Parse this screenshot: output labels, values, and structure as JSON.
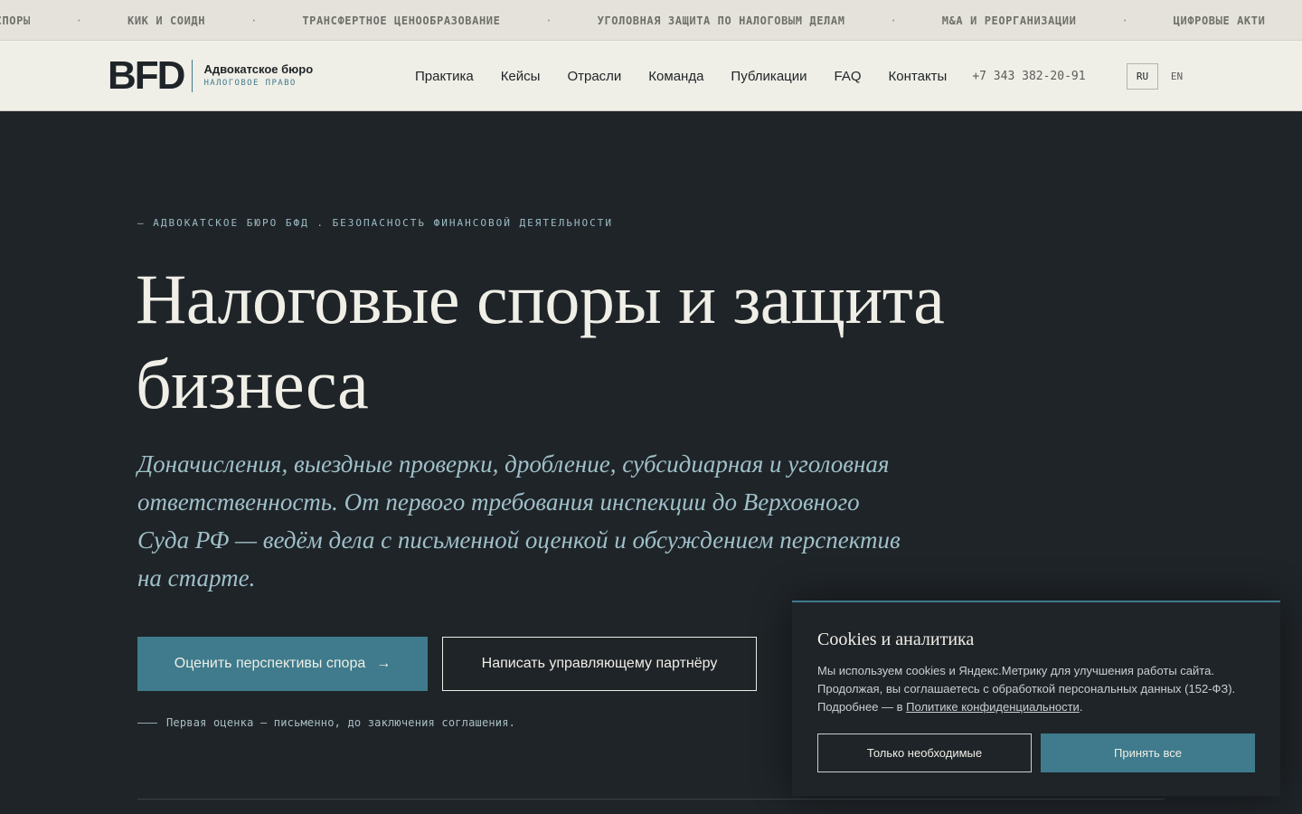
{
  "ticker": {
    "items": [
      "Е СПОРЫ",
      "КИК И СОИДН",
      "ТРАНСФЕРТНОЕ ЦЕНООБРАЗОВАНИЕ",
      "УГОЛОВНАЯ ЗАЩИТА ПО НАЛОГОВЫМ ДЕЛАМ",
      "M&A И РЕОРГАНИЗАЦИИ",
      "ЦИФРОВЫЕ АКТИ"
    ],
    "separator": "·"
  },
  "header": {
    "logo_mark": "BFD",
    "logo_title": "Адвокатское бюро",
    "logo_subtitle": "НАЛОГОВОЕ ПРАВО",
    "nav": [
      "Практика",
      "Кейсы",
      "Отрасли",
      "Команда",
      "Публикации",
      "FAQ",
      "Контакты"
    ],
    "phone": "+7 343 382-20-91",
    "lang_ru": "RU",
    "lang_en": "EN"
  },
  "hero": {
    "eyebrow": "— АДВОКАТСКОЕ БЮРО БФД . БЕЗОПАСНОСТЬ ФИНАНСОВОЙ ДЕЯТЕЛЬНОСТИ",
    "title": "Налоговые споры и защита бизнеса",
    "lead": "Доначисления, выездные проверки, дробление, субсидиарная и уголовная ответственность. От первого требования инспекции до Верховного Суда РФ — ведём дела с письменной оценкой и обсуждением перспектив на старте.",
    "primary_button": "Оценить перспективы спора",
    "primary_arrow": "→",
    "secondary_button": "Написать управляющему партнёру",
    "note": "Первая оценка — письменно, до заключения соглашения."
  },
  "cookie": {
    "title": "Cookies и аналитика",
    "text": "Мы используем cookies и Яндекс.Метрику для улучшения работы сайта. Продолжая, вы соглашаетесь с обработкой персональных данных (152-ФЗ). Подробнее — в ",
    "link": "Политике конфиденциальности",
    "text_end": ".",
    "button_necessary": "Только необходимые",
    "button_accept": "Принять все"
  },
  "colors": {
    "accent": "#3f7b8c",
    "dark_bg": "#1f2428",
    "light_bg": "#efeee7"
  }
}
